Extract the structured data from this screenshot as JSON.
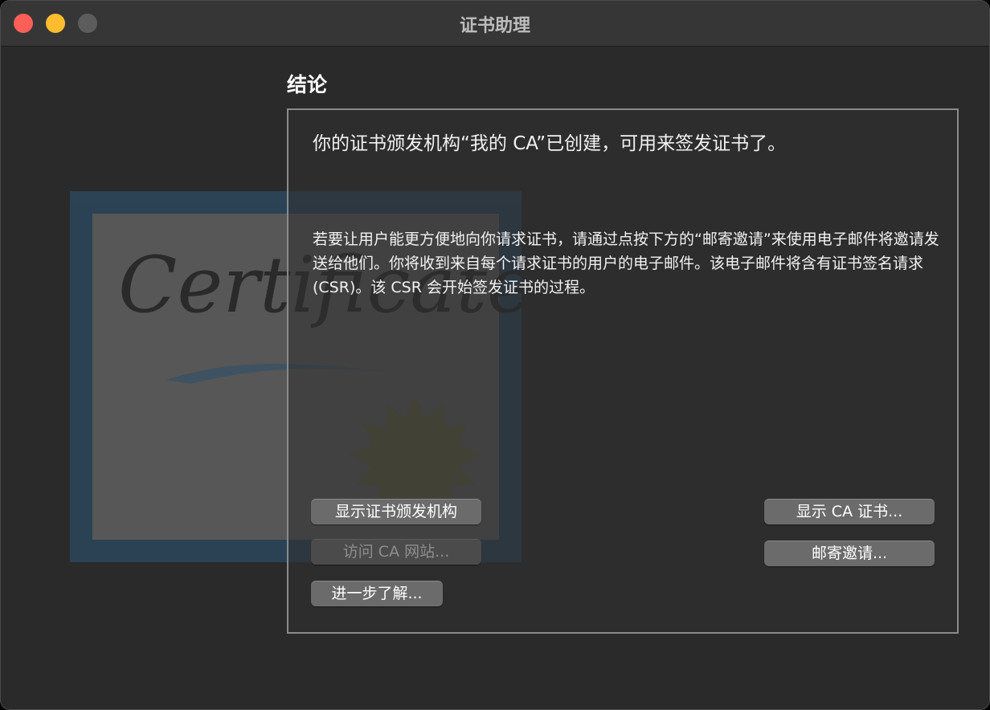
{
  "window": {
    "title": "证书助理",
    "controls": [
      "close",
      "minimize",
      "maximize"
    ]
  },
  "page": {
    "heading": "结论",
    "main_message": "你的证书颁发机构“我的 CA”已创建，可用来签发证书了。",
    "sub_message": "若要让用户能更方便地向你请求证书，请通过点按下方的“邮寄邀请”来使用电子邮件将邀请发送给他们。你将收到来自每个请求证书的用户的电子邮件。该电子邮件将含有证书签名请求 (CSR)。该 CSR 会开始签发证书的过程。"
  },
  "illustration": {
    "script_text": "Certificate"
  },
  "buttons": {
    "show_ca": "显示证书颁发机构",
    "visit_ca_site": "访问 CA 网站...",
    "learn_more": "进一步了解...",
    "show_ca_cert": "显示 CA 证书...",
    "mail_invite": "邮寄邀请..."
  },
  "colors": {
    "close": "#ff5f57",
    "minimize": "#febc2e",
    "maximize": "#5c5c5c",
    "background": "#2a2a2a"
  }
}
